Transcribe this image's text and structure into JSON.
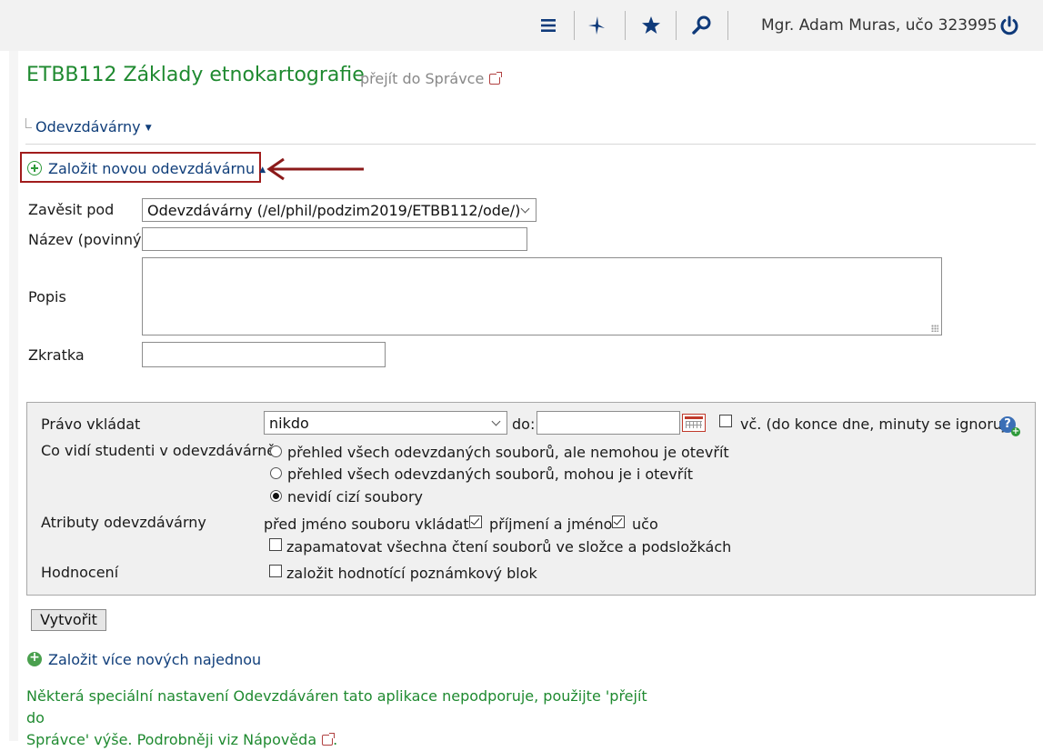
{
  "topbar": {
    "icons": [
      "menu-icon",
      "pin-icon",
      "star-icon",
      "search-icon",
      "power-icon"
    ],
    "user_label": "Mgr. Adam Muras, učo 323995"
  },
  "header": {
    "title": "ETBB112 Základy etnokartografie",
    "admin_link": "přejít do Správce"
  },
  "breadcrumb": {
    "label": "Odevzdávárny"
  },
  "create_link": {
    "label": "Založit novou odevzdávárnu"
  },
  "form": {
    "parent_label": "Zavěsit pod",
    "parent_value": "Odevzdávárny (/el/phil/podzim2019/ETBB112/ode/)",
    "name_label": "Název (povinný)",
    "name_value": "",
    "desc_label": "Popis",
    "desc_value": "",
    "short_label": "Zkratka",
    "short_value": ""
  },
  "panel": {
    "right_label": "Právo vkládat",
    "right_value": "nikdo",
    "do_label": "do:",
    "do_value": "",
    "inclusive_label": "vč. (do konce dne, minuty se ignorují)",
    "inclusive_checked": false,
    "students_label": "Co vidí studenti v odevzdávárně",
    "students_options": [
      "přehled všech odevzdaných souborů, ale nemohou je otevřít",
      "přehled všech odevzdaných souborů, mohou je i otevřít",
      "nevidí cizí soubory"
    ],
    "students_selected": 2,
    "attrs_label": "Atributy odevzdávárny",
    "attrs_prefix": "před jméno souboru vkládat",
    "attr_name_label": "příjmení a jméno",
    "attr_name_checked": true,
    "attr_uco_label": "učo",
    "attr_uco_checked": true,
    "remember_label": "zapamatovat všechna čtení souborů ve složce a podsložkách",
    "remember_checked": false,
    "grading_label": "Hodnocení",
    "grading_option": "založit hodnotící poznámkový blok",
    "grading_checked": false
  },
  "buttons": {
    "create": "Vytvořit"
  },
  "multi_link": "Založit více nových najednou",
  "note": {
    "line1": "Některá speciální nastavení Odevzdáváren tato aplikace nepodporuje, použijte 'přejít do",
    "line2": "Správce' výše. Podrobněji viz Nápověda",
    "end": "."
  },
  "colors": {
    "title_green": "#1f8a30",
    "link_blue": "#103e7a",
    "highlight_red": "#a11c1c"
  }
}
